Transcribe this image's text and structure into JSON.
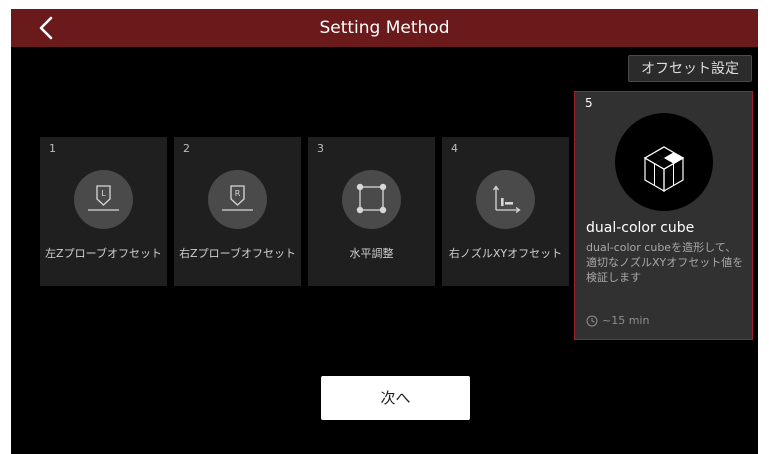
{
  "header": {
    "title": "Setting Method"
  },
  "offset_button": {
    "label": "オフセット設定"
  },
  "methods": [
    {
      "number": "1",
      "label": "左Zプローブオフセット",
      "icon": "left-z-probe-icon"
    },
    {
      "number": "2",
      "label": "右Zプローブオフセット",
      "icon": "right-z-probe-icon"
    },
    {
      "number": "3",
      "label": "水平調整",
      "icon": "leveling-icon"
    },
    {
      "number": "4",
      "label": "右ノズルXYオフセット",
      "icon": "xy-offset-icon"
    }
  ],
  "selected": {
    "number": "5",
    "title": "dual-color cube",
    "description": "dual-color cubeを造形して、適切なノズルXYオフセット値を検証します",
    "time": "~15 min",
    "icon": "dual-color-cube-icon"
  },
  "next_button": {
    "label": "次へ"
  },
  "colors": {
    "header": "#6b1a1b",
    "accent": "#9b2327",
    "background": "#000000",
    "card": "#1f1f1f"
  }
}
